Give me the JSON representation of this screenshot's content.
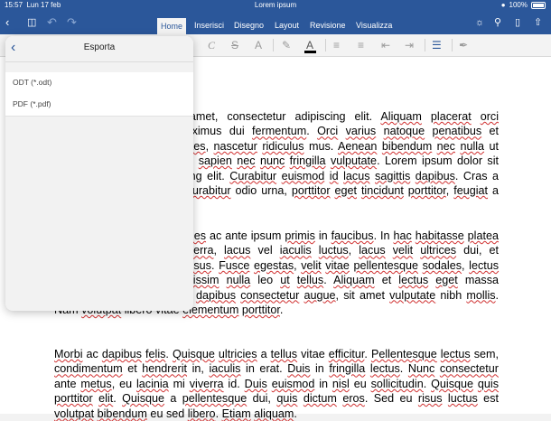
{
  "status_bar": {
    "time": "15:57",
    "date": "Lun 17 feb",
    "document": "Lorem ipsum",
    "battery": "100%"
  },
  "ribbon": {
    "tabs": [
      "Home",
      "Inserisci",
      "Disegno",
      "Layout",
      "Revisione",
      "Visualizza"
    ],
    "active_tab": "Home"
  },
  "toolbar": {
    "italic_label": "C",
    "strike_label": "S",
    "font_color_label": "A",
    "clear_format_label": "A"
  },
  "export_panel": {
    "title": "Esporta",
    "options": [
      "ODT (*.odt)",
      "PDF (*.pdf)"
    ]
  },
  "colors": {
    "accent": "#2b579a"
  }
}
